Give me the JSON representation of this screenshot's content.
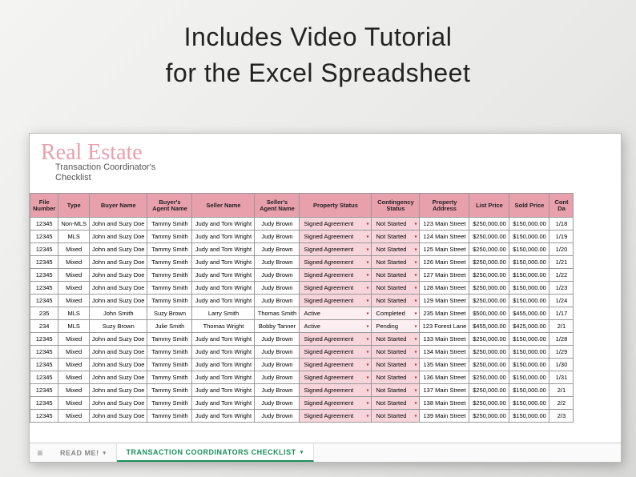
{
  "headline": {
    "line1": "Includes Video Tutorial",
    "line2": "for the Excel Spreadsheet"
  },
  "sheet": {
    "script_title": "Real Estate",
    "subtitle_line1": "Transaction Coordinator's",
    "subtitle_line2": "Checklist"
  },
  "columns": {
    "file": "File Number",
    "type": "Type",
    "buyer": "Buyer Name",
    "bagent": "Buyer's Agent Name",
    "seller": "Seller Name",
    "sagent": "Seller's Agent Name",
    "pstatus": "Property Status",
    "cstatus": "Contingency Status",
    "addr": "Property Address",
    "list": "List Price",
    "sold": "Sold Price",
    "date": "Cont Da"
  },
  "rows": [
    {
      "file": "12345",
      "type": "Non-MLS",
      "buyer": "John and Suzy Doe",
      "bagent": "Tammy Smith",
      "seller": "Judy and Tom Wright",
      "sagent": "Judy Brown",
      "pstatus": "Signed Agreement",
      "cstatus": "Not Started",
      "addr": "123 Main Street",
      "list": "$250,000.00",
      "sold": "$150,000.00",
      "date": "1/18"
    },
    {
      "file": "12345",
      "type": "MLS",
      "buyer": "John and Suzy Doe",
      "bagent": "Tammy Smith",
      "seller": "Judy and Tom Wright",
      "sagent": "Judy Brown",
      "pstatus": "Signed Agreement",
      "cstatus": "Not Started",
      "addr": "124 Main Street",
      "list": "$250,000.00",
      "sold": "$150,000.00",
      "date": "1/19"
    },
    {
      "file": "12345",
      "type": "Mixed",
      "buyer": "John and Suzy Doe",
      "bagent": "Tammy Smith",
      "seller": "Judy and Tom Wright",
      "sagent": "Judy Brown",
      "pstatus": "Signed Agreement",
      "cstatus": "Not Started",
      "addr": "125 Main Street",
      "list": "$250,000.00",
      "sold": "$150,000.00",
      "date": "1/20"
    },
    {
      "file": "12345",
      "type": "Mixed",
      "buyer": "John and Suzy Doe",
      "bagent": "Tammy Smith",
      "seller": "Judy and Tom Wright",
      "sagent": "Judy Brown",
      "pstatus": "Signed Agreement",
      "cstatus": "Not Started",
      "addr": "126 Main Street",
      "list": "$250,000.00",
      "sold": "$150,000.00",
      "date": "1/21"
    },
    {
      "file": "12345",
      "type": "Mixed",
      "buyer": "John and Suzy Doe",
      "bagent": "Tammy Smith",
      "seller": "Judy and Tom Wright",
      "sagent": "Judy Brown",
      "pstatus": "Signed Agreement",
      "cstatus": "Not Started",
      "addr": "127 Main Street",
      "list": "$250,000.00",
      "sold": "$150,000.00",
      "date": "1/22"
    },
    {
      "file": "12345",
      "type": "Mixed",
      "buyer": "John and Suzy Doe",
      "bagent": "Tammy Smith",
      "seller": "Judy and Tom Wright",
      "sagent": "Judy Brown",
      "pstatus": "Signed Agreement",
      "cstatus": "Not Started",
      "addr": "128 Main Street",
      "list": "$250,000.00",
      "sold": "$150,000.00",
      "date": "1/23"
    },
    {
      "file": "12345",
      "type": "Mixed",
      "buyer": "John and Suzy Doe",
      "bagent": "Tammy Smith",
      "seller": "Judy and Tom Wright",
      "sagent": "Judy Brown",
      "pstatus": "Signed Agreement",
      "cstatus": "Not Started",
      "addr": "129 Main Street",
      "list": "$250,000.00",
      "sold": "$150,000.00",
      "date": "1/24"
    },
    {
      "file": "235",
      "type": "MLS",
      "buyer": "John Smith",
      "bagent": "Suzy Brown",
      "seller": "Larry Smith",
      "sagent": "Thomas Smith",
      "pstatus": "Active",
      "cstatus": "Completed",
      "addr": "235 Main Street",
      "list": "$500,000.00",
      "sold": "$455,000.00",
      "date": "1/17"
    },
    {
      "file": "234",
      "type": "MLS",
      "buyer": "Suzy Brown",
      "bagent": "Julie Smith",
      "seller": "Thomas Wright",
      "sagent": "Bobby Tanner",
      "pstatus": "Active",
      "cstatus": "Pending",
      "addr": "123 Forest Lane",
      "list": "$455,000.00",
      "sold": "$425,000.00",
      "date": "2/1"
    },
    {
      "file": "12345",
      "type": "Mixed",
      "buyer": "John and Suzy Doe",
      "bagent": "Tammy Smith",
      "seller": "Judy and Tom Wright",
      "sagent": "Judy Brown",
      "pstatus": "Signed Agreement",
      "cstatus": "Not Started",
      "addr": "133 Main Street",
      "list": "$250,000.00",
      "sold": "$150,000.00",
      "date": "1/28"
    },
    {
      "file": "12345",
      "type": "Mixed",
      "buyer": "John and Suzy Doe",
      "bagent": "Tammy Smith",
      "seller": "Judy and Tom Wright",
      "sagent": "Judy Brown",
      "pstatus": "Signed Agreement",
      "cstatus": "Not Started",
      "addr": "134 Main Street",
      "list": "$250,000.00",
      "sold": "$150,000.00",
      "date": "1/29"
    },
    {
      "file": "12345",
      "type": "Mixed",
      "buyer": "John and Suzy Doe",
      "bagent": "Tammy Smith",
      "seller": "Judy and Tom Wright",
      "sagent": "Judy Brown",
      "pstatus": "Signed Agreement",
      "cstatus": "Not Started",
      "addr": "135 Main Street",
      "list": "$250,000.00",
      "sold": "$150,000.00",
      "date": "1/30"
    },
    {
      "file": "12345",
      "type": "Mixed",
      "buyer": "John and Suzy Doe",
      "bagent": "Tammy Smith",
      "seller": "Judy and Tom Wright",
      "sagent": "Judy Brown",
      "pstatus": "Signed Agreement",
      "cstatus": "Not Started",
      "addr": "136 Main Street",
      "list": "$250,000.00",
      "sold": "$150,000.00",
      "date": "1/31"
    },
    {
      "file": "12345",
      "type": "Mixed",
      "buyer": "John and Suzy Doe",
      "bagent": "Tammy Smith",
      "seller": "Judy and Tom Wright",
      "sagent": "Judy Brown",
      "pstatus": "Signed Agreement",
      "cstatus": "Not Started",
      "addr": "137 Main Street",
      "list": "$250,000.00",
      "sold": "$150,000.00",
      "date": "2/1"
    },
    {
      "file": "12345",
      "type": "Mixed",
      "buyer": "John and Suzy Doe",
      "bagent": "Tammy Smith",
      "seller": "Judy and Tom Wright",
      "sagent": "Judy Brown",
      "pstatus": "Signed Agreement",
      "cstatus": "Not Started",
      "addr": "138 Main Street",
      "list": "$250,000.00",
      "sold": "$150,000.00",
      "date": "2/2"
    },
    {
      "file": "12345",
      "type": "Mixed",
      "buyer": "John and Suzy Doe",
      "bagent": "Tammy Smith",
      "seller": "Judy and Tom Wright",
      "sagent": "Judy Brown",
      "pstatus": "Signed Agreement",
      "cstatus": "Not Started",
      "addr": "139 Main Street",
      "list": "$250,000.00",
      "sold": "$150,000.00",
      "date": "2/3"
    }
  ],
  "tabs": {
    "readme": "READ ME!",
    "active": "TRANSACTION COORDINATORS CHECKLIST"
  }
}
